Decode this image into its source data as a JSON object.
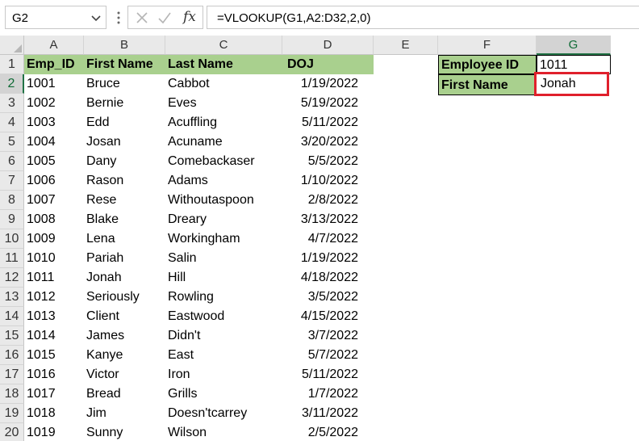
{
  "formula_bar": {
    "name_box": "G2",
    "formula": "=VLOOKUP(G1,A2:D32,2,0)",
    "fx_label": "fx"
  },
  "columns": [
    "A",
    "B",
    "C",
    "D",
    "E",
    "F",
    "G"
  ],
  "rows": [
    "1",
    "2",
    "3",
    "4",
    "5",
    "6",
    "7",
    "8",
    "9",
    "10",
    "11",
    "12",
    "13",
    "14",
    "15",
    "16",
    "17",
    "18",
    "19",
    "20"
  ],
  "table": {
    "headers": [
      "Emp_ID",
      "First Name",
      "Last Name",
      "DOJ"
    ],
    "rows": [
      [
        "1001",
        "Bruce",
        "Cabbot",
        "1/19/2022"
      ],
      [
        "1002",
        "Bernie",
        "Eves",
        "5/19/2022"
      ],
      [
        "1003",
        "Edd",
        "Acuffling",
        "5/11/2022"
      ],
      [
        "1004",
        "Josan",
        "Acuname",
        "3/20/2022"
      ],
      [
        "1005",
        "Dany",
        "Comebackaser",
        "5/5/2022"
      ],
      [
        "1006",
        "Rason",
        "Adams",
        "1/10/2022"
      ],
      [
        "1007",
        "Rese",
        "Withoutaspoon",
        "2/8/2022"
      ],
      [
        "1008",
        "Blake",
        "Dreary",
        "3/13/2022"
      ],
      [
        "1009",
        "Lena",
        "Workingham",
        "4/7/2022"
      ],
      [
        "1010",
        "Pariah",
        "Salin",
        "1/19/2022"
      ],
      [
        "1011",
        "Jonah",
        "Hill",
        "4/18/2022"
      ],
      [
        "1012",
        "Seriously",
        "Rowling",
        "3/5/2022"
      ],
      [
        "1013",
        "Client",
        "Eastwood",
        "4/15/2022"
      ],
      [
        "1014",
        "James",
        "Didn't",
        "3/7/2022"
      ],
      [
        "1015",
        "Kanye",
        "East",
        "5/7/2022"
      ],
      [
        "1016",
        "Victor",
        "Iron",
        "5/11/2022"
      ],
      [
        "1017",
        "Bread",
        "Grills",
        "1/7/2022"
      ],
      [
        "1018",
        "Jim",
        "Doesn'tcarrey",
        "3/11/2022"
      ],
      [
        "1019",
        "Sunny",
        "Wilson",
        "2/5/2022"
      ]
    ]
  },
  "lookup": {
    "label_id": "Employee ID",
    "value_id": "1011",
    "label_name": "First Name",
    "value_name": "Jonah"
  },
  "colors": {
    "header_fill": "#a9d08e",
    "highlight_border": "#e0202c",
    "excel_green": "#217346"
  }
}
